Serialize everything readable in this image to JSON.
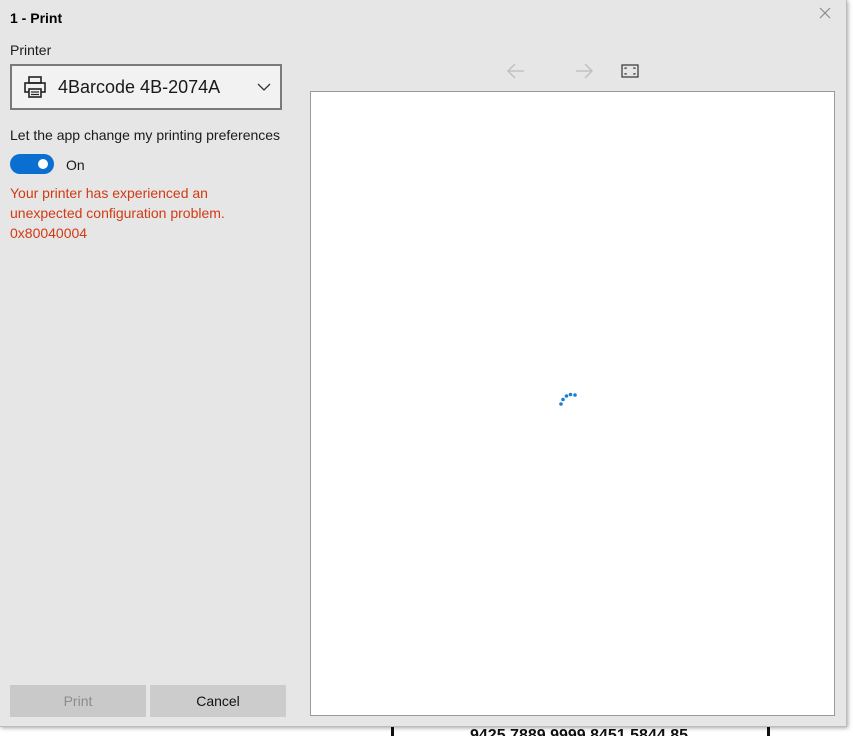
{
  "dialog": {
    "title": "1 - Print",
    "close_icon": "close-icon"
  },
  "printer": {
    "label": "Printer",
    "selected": "4Barcode 4B-2074A",
    "icon": "printer-icon"
  },
  "preferences": {
    "label": "Let the app change my printing preferences",
    "toggle_state": "On",
    "toggle_on": true
  },
  "error": {
    "line1": "Your printer has experienced an",
    "line2": "unexpected configuration problem.",
    "code": "0x80040004"
  },
  "preview_nav": {
    "prev_icon": "arrow-left-icon",
    "next_icon": "arrow-right-icon",
    "fit_icon": "fit-page-icon"
  },
  "buttons": {
    "print": "Print",
    "cancel": "Cancel"
  },
  "colors": {
    "accent": "#0a6fd1",
    "error": "#d13a14",
    "spinner": "#1a7fd4",
    "panel": "#e6e6e6"
  },
  "background_window": {
    "partial_text": "9425 7889 9999 8451 5844 85"
  }
}
